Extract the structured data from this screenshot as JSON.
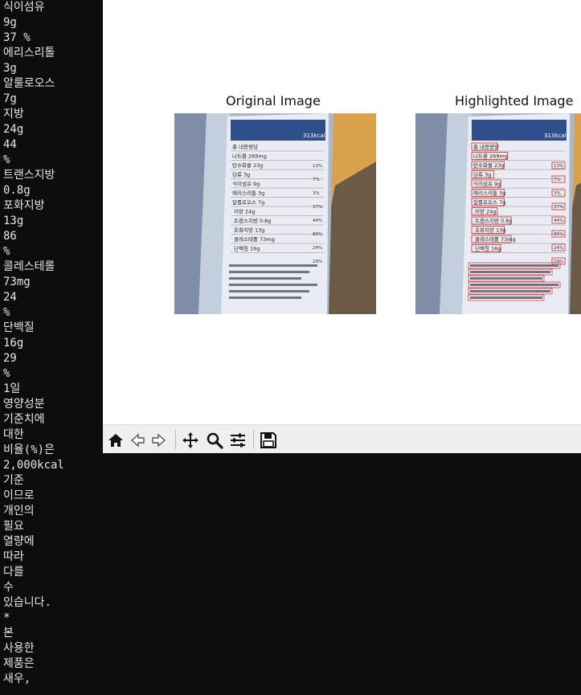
{
  "terminal": {
    "lines": [
      "식이섬유",
      "9g",
      "37 %",
      "에리스리톨",
      "3g",
      "알룰로오스",
      "7g",
      "지방",
      "24g",
      "44",
      "%",
      "트랜스지방",
      "0.8g",
      "포화지방",
      "13g",
      "86",
      "%",
      "콜레스테롤",
      "73mg",
      "24",
      "%",
      "단백질",
      "16g",
      "29",
      "%",
      "1일",
      "영양성분",
      "기준치에",
      "대한",
      "비율(%)은",
      "2,000kcal",
      "기준",
      "이므로",
      "개인의",
      "필요",
      "열량에",
      "따라",
      "다를",
      "수",
      "있습니다.",
      "*",
      "본",
      "사용한",
      "제품은",
      "새우,"
    ]
  },
  "figure": {
    "left_title": "Original Image",
    "right_title": "Highlighted Image",
    "label_lines": [
      "총 내용량당",
      "나트륨 269mg",
      "탄수화물 23g",
      "당류 3g",
      "식이섬유 9g",
      "에리스리톨 3g",
      "알룰로오스 7g",
      "지방 24g",
      "트랜스지방 0.8g",
      "포화지방 13g",
      "콜레스테롤 73mg",
      "단백질 16g"
    ],
    "percents": [
      "13%",
      "7%",
      "3%",
      "37%",
      "44%",
      "86%",
      "24%",
      "29%"
    ],
    "kcal": "313kcal",
    "highlight_color": "#e02020"
  },
  "toolbar": {
    "icons": [
      "home-icon",
      "back-icon",
      "forward-icon",
      "pan-icon",
      "zoom-icon",
      "configure-subplots-icon",
      "save-icon"
    ]
  }
}
